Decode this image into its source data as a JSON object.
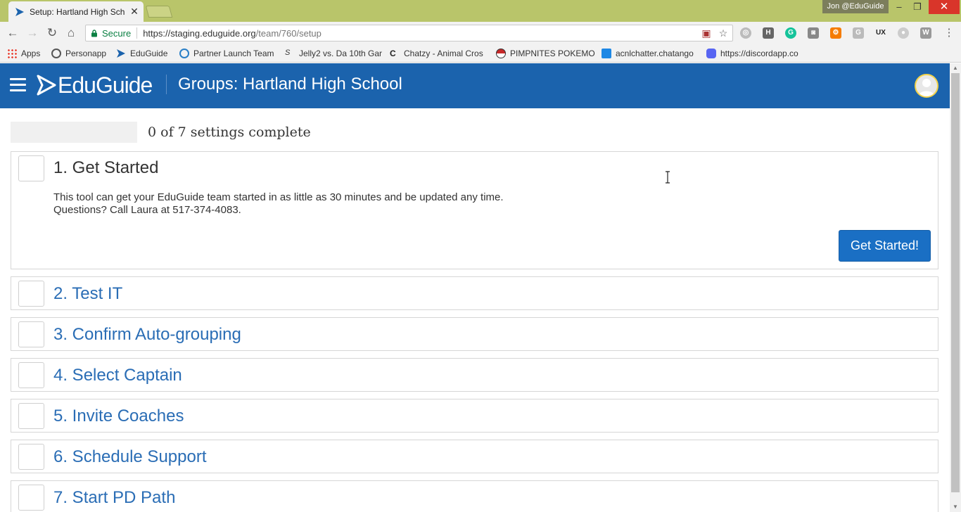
{
  "browser": {
    "tab_title": "Setup: Hartland High Sch",
    "profile_name": "Jon @EduGuide",
    "omnibox": {
      "secure_label": "Secure",
      "url_host": "https://staging.eduguide.org",
      "url_path": "/team/760/setup"
    },
    "bookmarks": [
      {
        "label": "Apps",
        "icon": "apps-grid-icon",
        "color": "#4285f4"
      },
      {
        "label": "Personapp",
        "icon": "personapp-icon",
        "color": "#555555"
      },
      {
        "label": "EduGuide",
        "icon": "eduguide-icon",
        "color": "#1b63ad"
      },
      {
        "label": "Partner Launch Team",
        "icon": "partner-icon",
        "color": "#2a7fc7"
      },
      {
        "label": "Jelly2 vs. Da 10th Gar",
        "icon": "jelly-icon",
        "color": "#3a3a3a"
      },
      {
        "label": "Chatzy - Animal Cros",
        "icon": "chatzy-icon",
        "color": "#222222"
      },
      {
        "label": "PIMPNITES POKEMO",
        "icon": "pokeball-icon",
        "color": "#c62828"
      },
      {
        "label": "acnlchatter.chatango",
        "icon": "chatango-icon",
        "color": "#1e88e5"
      },
      {
        "label": "https://discordapp.co",
        "icon": "discord-icon",
        "color": "#5865f2"
      }
    ]
  },
  "app": {
    "brand": "EduGuide",
    "page_title": "Groups: Hartland High School"
  },
  "progress": {
    "completed": 0,
    "total": 7,
    "label": "0 of 7 settings complete"
  },
  "steps": [
    {
      "title": "1. Get Started",
      "expanded": true,
      "description_line1": "This tool can get your EduGuide team started in as little as 30 minutes and be updated any time.",
      "description_line2": "Questions? Call Laura at 517-374-4083.",
      "button": "Get Started!"
    },
    {
      "title": "2. Test IT"
    },
    {
      "title": "3. Confirm Auto-grouping"
    },
    {
      "title": "4. Select Captain"
    },
    {
      "title": "5. Invite Coaches"
    },
    {
      "title": "6. Schedule Support"
    },
    {
      "title": "7. Start PD Path"
    }
  ]
}
